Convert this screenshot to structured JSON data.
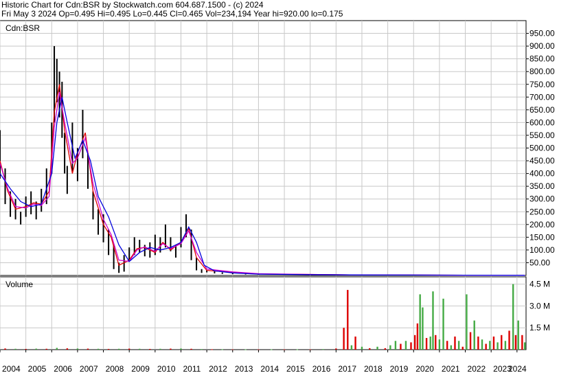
{
  "header": {
    "line1": "Historic Chart for Cdn:BSR by Stockwatch.com 604.687.1500 - (c) 2024",
    "line2": "Fri May  3 2024  Op=0.495  Hi=0.495  Lo=0.445  Cl=0.465  Vol=234,194  Year hi=920.00  lo=0.175"
  },
  "colors": {
    "price_bar": "#000000",
    "ma_short": "#e00000",
    "ma_mid": "#cc00cc",
    "ma_long": "#0000dd",
    "grid": "#c8c8c8",
    "volume_up": "#44aa44",
    "volume_down": "#dd0000",
    "border": "#000000"
  },
  "chart_data": [
    {
      "type": "line",
      "title": "Cdn:BSR",
      "ylim": [
        0,
        1000
      ],
      "y_ticks": [
        "950.00",
        "900.00",
        "850.00",
        "800.00",
        "750.00",
        "700.00",
        "650.00",
        "600.00",
        "550.00",
        "500.00",
        "450.00",
        "400.00",
        "350.00",
        "300.00",
        "250.00",
        "200.00",
        "150.00",
        "100.00",
        "50.00"
      ],
      "y_tick_values": [
        950,
        900,
        850,
        800,
        750,
        700,
        650,
        600,
        550,
        500,
        450,
        400,
        350,
        300,
        250,
        200,
        150,
        100,
        50
      ],
      "x_labels": [
        "2004",
        "2005",
        "2006",
        "2007",
        "2008",
        "2009",
        "2010",
        "2011",
        "2012",
        "2013",
        "2014",
        "2015",
        "2016",
        "2017",
        "2018",
        "2019",
        "2020",
        "2021",
        "2022",
        "2023",
        "2024"
      ],
      "grid": true,
      "series": [
        {
          "style": "price_bars",
          "x": [
            2004.0,
            2004.2,
            2004.4,
            2004.6,
            2004.8,
            2005.0,
            2005.2,
            2005.4,
            2005.6,
            2005.8,
            2006.0,
            2006.1,
            2006.2,
            2006.3,
            2006.4,
            2006.5,
            2006.6,
            2006.8,
            2007.0,
            2007.2,
            2007.4,
            2007.6,
            2007.8,
            2008.0,
            2008.2,
            2008.4,
            2008.6,
            2008.8,
            2009.0,
            2009.2,
            2009.4,
            2009.6,
            2009.8,
            2010.0,
            2010.2,
            2010.4,
            2010.6,
            2010.8,
            2011.0,
            2011.2,
            2011.4,
            2011.6,
            2011.8,
            2012.0,
            2012.3,
            2012.6,
            2013.0,
            2013.5,
            2014.0,
            2015.0,
            2016.0,
            2017.0,
            2018.0,
            2019.0,
            2020.0,
            2021.0,
            2022.0,
            2023.0,
            2024.0,
            2024.3
          ],
          "high": [
            570,
            420,
            330,
            300,
            250,
            310,
            330,
            290,
            340,
            420,
            600,
            900,
            850,
            800,
            760,
            560,
            430,
            600,
            500,
            650,
            480,
            330,
            260,
            240,
            180,
            120,
            50,
            80,
            110,
            150,
            140,
            120,
            130,
            160,
            150,
            200,
            150,
            120,
            190,
            240,
            180,
            70,
            25,
            20,
            16,
            12,
            10,
            8,
            6,
            5,
            4,
            3,
            3,
            2,
            2,
            2,
            2,
            1.5,
            1,
            1
          ],
          "low": [
            380,
            280,
            230,
            220,
            200,
            230,
            240,
            220,
            250,
            280,
            400,
            600,
            680,
            620,
            540,
            400,
            320,
            410,
            370,
            460,
            340,
            220,
            160,
            130,
            80,
            25,
            10,
            15,
            60,
            80,
            90,
            75,
            70,
            80,
            90,
            110,
            95,
            70,
            110,
            150,
            60,
            20,
            10,
            12,
            8,
            6,
            5,
            4,
            3,
            2,
            1.5,
            1,
            0.8,
            0.5,
            0.5,
            0.4,
            0.4,
            0.3,
            0.3,
            0.3
          ]
        },
        {
          "style": "moving_average",
          "color_key": "ma_short",
          "x": [
            2004.0,
            2004.3,
            2004.6,
            2005.0,
            2005.3,
            2005.6,
            2005.9,
            2006.1,
            2006.3,
            2006.5,
            2006.8,
            2007.0,
            2007.3,
            2007.6,
            2008.0,
            2008.3,
            2008.6,
            2009.0,
            2009.3,
            2009.6,
            2010.0,
            2010.3,
            2010.6,
            2011.0,
            2011.3,
            2011.6,
            2012.0,
            2013.0,
            2014.0,
            2016.0,
            2018.0,
            2020.0,
            2022.0,
            2024.0,
            2024.3
          ],
          "values": [
            450,
            330,
            260,
            270,
            285,
            280,
            330,
            640,
            750,
            570,
            400,
            480,
            560,
            330,
            200,
            150,
            40,
            60,
            105,
            110,
            90,
            130,
            100,
            130,
            185,
            70,
            20,
            12,
            6,
            4,
            2,
            1.5,
            1,
            0.6,
            0.5
          ]
        },
        {
          "style": "moving_average",
          "color_key": "ma_mid",
          "x": [
            2004.0,
            2004.3,
            2004.6,
            2005.0,
            2005.3,
            2005.6,
            2005.9,
            2006.1,
            2006.3,
            2006.5,
            2006.8,
            2007.0,
            2007.3,
            2007.6,
            2008.0,
            2008.3,
            2008.6,
            2009.0,
            2009.3,
            2009.6,
            2010.0,
            2010.3,
            2010.6,
            2011.0,
            2011.3,
            2011.6,
            2012.0,
            2013.0,
            2014.0,
            2016.0,
            2018.0,
            2020.0,
            2022.0,
            2024.0,
            2024.3
          ],
          "values": [
            440,
            340,
            270,
            265,
            280,
            275,
            310,
            580,
            720,
            600,
            440,
            460,
            540,
            360,
            220,
            160,
            60,
            55,
            100,
            112,
            95,
            125,
            105,
            125,
            175,
            90,
            25,
            14,
            7,
            4,
            2,
            1.5,
            1,
            0.6,
            0.5
          ]
        },
        {
          "style": "moving_average",
          "color_key": "ma_long",
          "x": [
            2004.0,
            2004.4,
            2004.8,
            2005.2,
            2005.6,
            2006.0,
            2006.2,
            2006.4,
            2006.6,
            2006.9,
            2007.2,
            2007.5,
            2007.8,
            2008.2,
            2008.6,
            2009.0,
            2009.4,
            2009.8,
            2010.2,
            2010.6,
            2011.0,
            2011.3,
            2011.6,
            2011.9,
            2012.3,
            2013.0,
            2014.0,
            2016.0,
            2018.0,
            2020.0,
            2022.0,
            2024.0,
            2024.3
          ],
          "values": [
            400,
            340,
            290,
            270,
            280,
            400,
            600,
            700,
            600,
            460,
            530,
            450,
            310,
            230,
            120,
            55,
            90,
            110,
            100,
            110,
            130,
            190,
            130,
            40,
            18,
            10,
            5,
            3,
            2,
            1.5,
            1,
            0.6,
            0.5
          ]
        }
      ]
    },
    {
      "type": "bar",
      "title": "Volume",
      "ylim": [
        0,
        5000000
      ],
      "y_ticks": [
        "4.5 M",
        "3.0 M",
        "1.5 M"
      ],
      "y_tick_values": [
        4500000,
        3000000,
        1500000
      ],
      "series": [
        {
          "style": "volume",
          "x": [
            2004.2,
            2004.6,
            2005.0,
            2005.4,
            2005.8,
            2006.2,
            2006.6,
            2007.0,
            2007.4,
            2007.8,
            2008.2,
            2008.6,
            2009.0,
            2009.4,
            2009.8,
            2010.2,
            2010.6,
            2011.0,
            2011.4,
            2011.8,
            2012.2,
            2012.6,
            2013.0,
            2013.5,
            2014.0,
            2014.5,
            2015.0,
            2015.5,
            2016.0,
            2016.5,
            2017.0,
            2017.3,
            2017.45,
            2017.6,
            2017.75,
            2018.0,
            2018.3,
            2018.6,
            2018.9,
            2019.1,
            2019.3,
            2019.5,
            2019.7,
            2019.9,
            2020.05,
            2020.15,
            2020.25,
            2020.35,
            2020.5,
            2020.65,
            2020.75,
            2020.85,
            2021.0,
            2021.15,
            2021.3,
            2021.45,
            2021.6,
            2021.75,
            2021.9,
            2022.05,
            2022.2,
            2022.35,
            2022.5,
            2022.65,
            2022.8,
            2022.95,
            2023.1,
            2023.25,
            2023.4,
            2023.55,
            2023.7,
            2023.85,
            2023.95,
            2024.05,
            2024.2,
            2024.3
          ],
          "values": [
            80000,
            60000,
            50000,
            70000,
            60000,
            120000,
            90000,
            80000,
            70000,
            60000,
            50000,
            60000,
            70000,
            60000,
            50000,
            60000,
            70000,
            80000,
            60000,
            40000,
            30000,
            30000,
            20000,
            20000,
            20000,
            20000,
            20000,
            20000,
            20000,
            40000,
            80000,
            1500000,
            4100000,
            300000,
            900000,
            200000,
            100000,
            200000,
            100000,
            300000,
            600000,
            400000,
            600000,
            500000,
            1000000,
            1800000,
            3800000,
            2900000,
            800000,
            900000,
            4000000,
            1000000,
            700000,
            3500000,
            600000,
            300000,
            900000,
            600000,
            200000,
            3800000,
            1200000,
            2000000,
            900000,
            700000,
            400000,
            600000,
            900000,
            500000,
            1000000,
            600000,
            1300000,
            4500000,
            1000000,
            2000000,
            1000000,
            500000
          ],
          "up": [
            false,
            true,
            false,
            true,
            false,
            true,
            false,
            true,
            false,
            true,
            false,
            true,
            false,
            true,
            false,
            true,
            false,
            true,
            false,
            true,
            false,
            true,
            false,
            true,
            false,
            true,
            false,
            true,
            false,
            true,
            false,
            false,
            false,
            true,
            false,
            true,
            false,
            true,
            false,
            true,
            true,
            false,
            true,
            false,
            false,
            false,
            true,
            true,
            false,
            true,
            true,
            false,
            true,
            true,
            false,
            true,
            false,
            true,
            false,
            true,
            false,
            true,
            false,
            true,
            false,
            true,
            false,
            true,
            false,
            true,
            false,
            true,
            false,
            true,
            false,
            true
          ]
        }
      ]
    }
  ]
}
